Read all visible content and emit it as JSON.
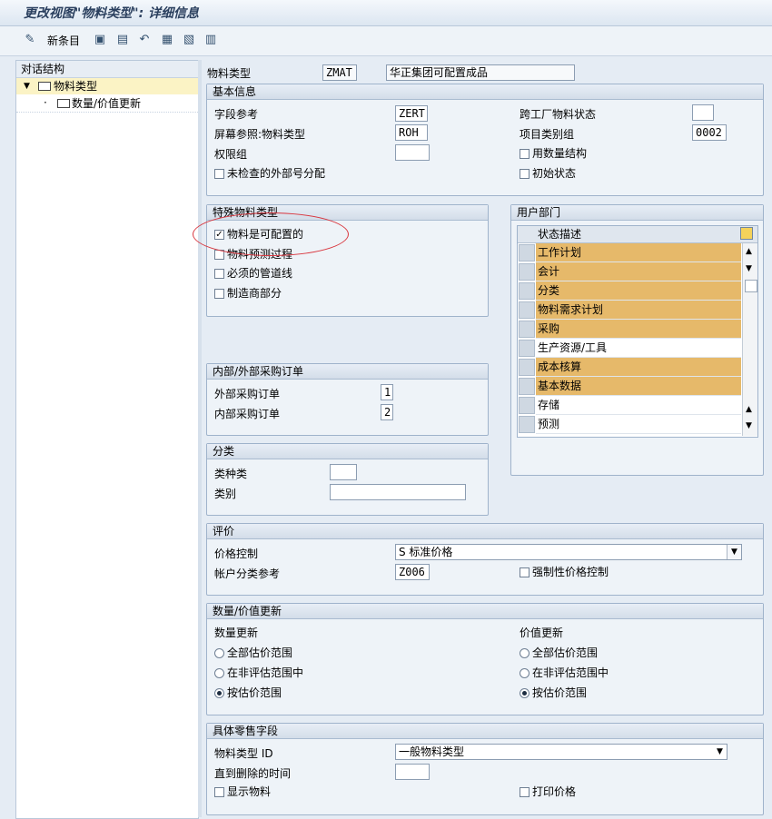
{
  "title": "更改视图\"物料类型\": 详细信息",
  "toolbar": {
    "new_entries": "新条目",
    "icons": [
      "pencil-glasses-icon",
      "copy-icon",
      "delete-icon",
      "undo-icon",
      "select-all-icon",
      "deselect-all-icon",
      "print-icon"
    ]
  },
  "nav": {
    "header": "对话结构",
    "items": [
      {
        "label": "物料类型",
        "expanded": true,
        "selected": true
      },
      {
        "label": "数量/价值更新",
        "expanded": false,
        "selected": false
      }
    ]
  },
  "header_fields": {
    "material_type_label": "物料类型",
    "material_type_value": "ZMAT",
    "material_type_desc": "华正集团可配置成品"
  },
  "basic": {
    "title": "基本信息",
    "field_ref_label": "字段参考",
    "field_ref_value": "ZERT",
    "screen_ref_label": "屏幕参照:物料类型",
    "screen_ref_value": "ROH",
    "auth_group_label": "权限组",
    "auth_group_value": "",
    "ext_num_label": "未检查的外部号分配",
    "ext_num_checked": false,
    "cross_plant_label": "跨工厂物料状态",
    "cross_plant_value": "",
    "item_cat_label": "项目类别组",
    "item_cat_value": "0002",
    "qty_struct_label": "用数量结构",
    "qty_struct_checked": false,
    "init_status_label": "初始状态",
    "init_status_checked": false
  },
  "special": {
    "title": "特殊物料类型",
    "items": [
      {
        "label": "物料是可配置的",
        "checked": true
      },
      {
        "label": "物料预测过程",
        "checked": false
      },
      {
        "label": "必须的管道线",
        "checked": false
      },
      {
        "label": "制造商部分",
        "checked": false
      }
    ]
  },
  "user_dept": {
    "title": "用户部门",
    "column": "状态描述",
    "rows": [
      {
        "label": "工作计划",
        "highlight": true
      },
      {
        "label": "会计",
        "highlight": true
      },
      {
        "label": "分类",
        "highlight": true
      },
      {
        "label": "物料需求计划",
        "highlight": true
      },
      {
        "label": "采购",
        "highlight": true
      },
      {
        "label": "生产资源/工具",
        "highlight": false
      },
      {
        "label": "成本核算",
        "highlight": true
      },
      {
        "label": "基本数据",
        "highlight": true
      },
      {
        "label": "存储",
        "highlight": false
      },
      {
        "label": "预测",
        "highlight": false
      }
    ],
    "highlight_color": "#e6b96a"
  },
  "po": {
    "title": "内部/外部采购订单",
    "external_label": "外部采购订单",
    "external_value": "1",
    "internal_label": "内部采购订单",
    "internal_value": "2"
  },
  "classification": {
    "title": "分类",
    "class_type_label": "类种类",
    "class_type_value": "",
    "class_label": "类别",
    "class_value": ""
  },
  "valuation": {
    "title": "评价",
    "price_control_label": "价格控制",
    "price_control_value": "S 标准价格",
    "acct_cat_label": "帐户分类参考",
    "acct_cat_value": "Z006",
    "force_price_label": "强制性价格控制",
    "force_price_checked": false
  },
  "qty_value": {
    "title": "数量/价值更新",
    "qty_label": "数量更新",
    "value_label": "价值更新",
    "options": [
      "全部估价范围",
      "在非评估范围中",
      "按估价范围"
    ],
    "qty_selected": 2,
    "value_selected": 2
  },
  "retail": {
    "title": "具体零售字段",
    "mtype_id_label": "物料类型 ID",
    "mtype_id_value": "一般物料类型",
    "deletion_label": "直到删除的时间",
    "deletion_value": "",
    "display_label": "显示物料",
    "display_checked": false,
    "print_price_label": "打印价格",
    "print_price_checked": false
  },
  "annotation_color": "#d9353d"
}
